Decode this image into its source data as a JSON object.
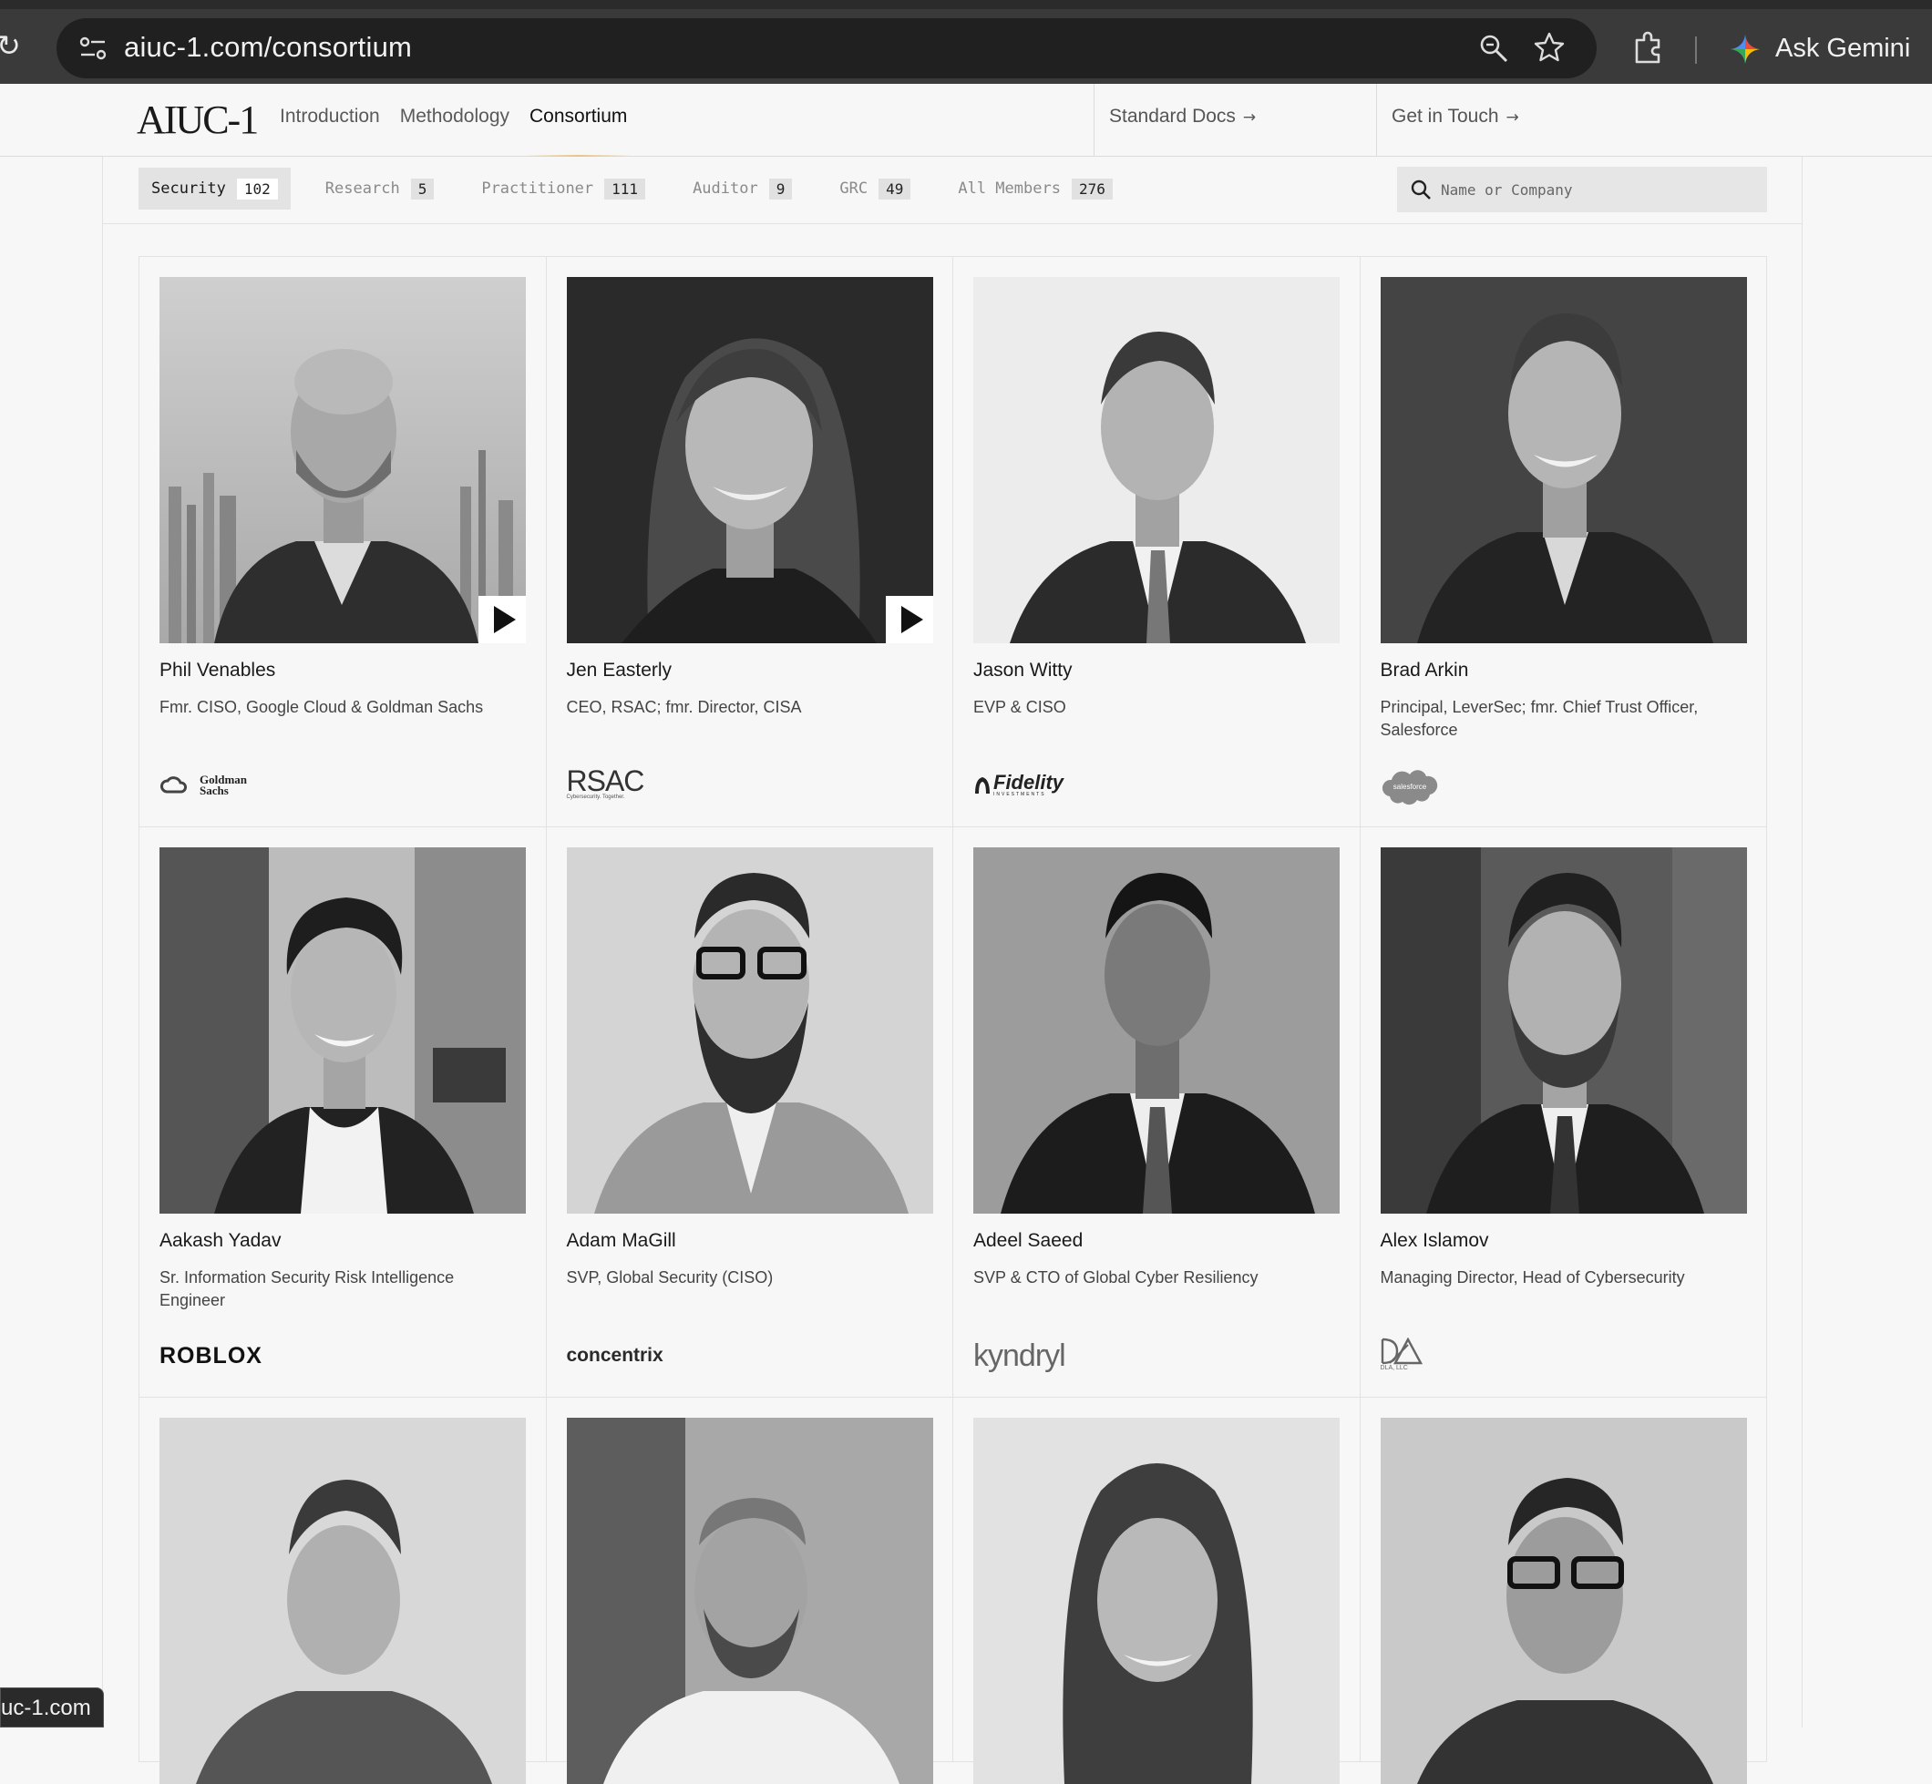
{
  "browser": {
    "url": "aiuc-1.com/consortium",
    "gemini_label": "Ask Gemini"
  },
  "header": {
    "logo": "AIUC-1",
    "nav": [
      "Introduction",
      "Methodology",
      "Consortium"
    ],
    "active_nav": "Consortium",
    "links": [
      {
        "label": "Standard Docs",
        "arrow": "→"
      },
      {
        "label": "Get in Touch",
        "arrow": "→"
      }
    ]
  },
  "filters": [
    {
      "label": "Security",
      "count": "102",
      "active": true
    },
    {
      "label": "Research",
      "count": "5"
    },
    {
      "label": "Practitioner",
      "count": "111"
    },
    {
      "label": "Auditor",
      "count": "9"
    },
    {
      "label": "GRC",
      "count": "49"
    },
    {
      "label": "All Members",
      "count": "276"
    }
  ],
  "search": {
    "placeholder": "Name or Company"
  },
  "members": [
    {
      "name": "Phil Venables",
      "title": "Fmr. CISO, Google Cloud & Goldman Sachs",
      "company": "Goldman Sachs",
      "has_video": true
    },
    {
      "name": "Jen Easterly",
      "title": "CEO, RSAC; fmr. Director, CISA",
      "company": "RSAC",
      "company_tagline": "Cybersecurity. Together.",
      "has_video": true
    },
    {
      "name": "Jason Witty",
      "title": "EVP & CISO",
      "company": "Fidelity",
      "company_tagline": "INVESTMENTS",
      "has_video": false
    },
    {
      "name": "Brad Arkin",
      "title": "Principal, LeverSec; fmr. Chief Trust Officer, Salesforce",
      "company": "salesforce",
      "has_video": false
    },
    {
      "name": "Aakash Yadav",
      "title": "Sr. Information Security Risk Intelligence Engineer",
      "company": "ROBLOX",
      "has_video": false
    },
    {
      "name": "Adam MaGill",
      "title": "SVP, Global Security (CISO)",
      "company": "concentrix",
      "has_video": false
    },
    {
      "name": "Adeel Saeed",
      "title": "SVP & CTO of Global Cyber Resiliency",
      "company": "kyndryl",
      "has_video": false
    },
    {
      "name": "Alex Islamov",
      "title": "Managing Director, Head of Cybersecurity",
      "company": "DLA, LLC",
      "has_video": false
    },
    {
      "name": "",
      "title": "",
      "company": "",
      "has_video": false
    },
    {
      "name": "",
      "title": "",
      "company": "",
      "has_video": false
    },
    {
      "name": "",
      "title": "",
      "company": "",
      "has_video": false
    },
    {
      "name": "",
      "title": "",
      "company": "",
      "has_video": false
    }
  ],
  "status_tooltip": "uc-1.com",
  "colors": {
    "chrome": "#3a3a3a",
    "omnibox": "#202020",
    "page_bg": "#f7f7f7",
    "active_underline": "#e8c48a",
    "salesforce_cloud": "#8a8a8a"
  }
}
